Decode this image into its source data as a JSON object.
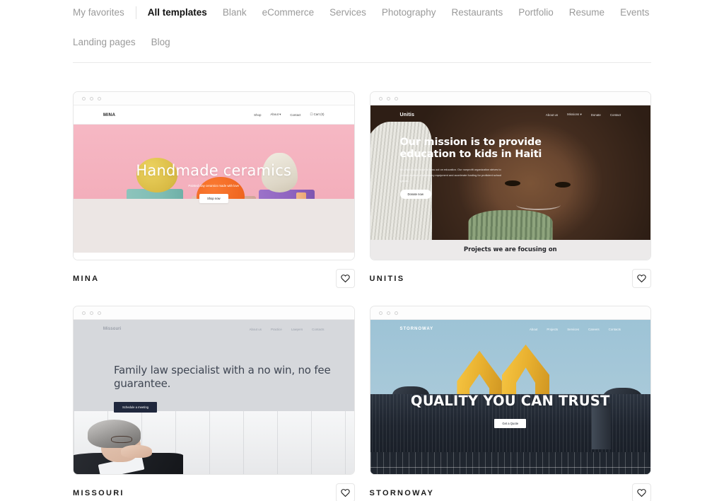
{
  "filter_bar": {
    "rows": [
      [
        {
          "label": "My favorites",
          "active": false
        },
        {
          "divider": true
        },
        {
          "label": "All templates",
          "active": true
        },
        {
          "label": "Blank",
          "active": false
        },
        {
          "label": "eCommerce",
          "active": false
        },
        {
          "label": "Services",
          "active": false
        },
        {
          "label": "Photography",
          "active": false
        },
        {
          "label": "Restaurants",
          "active": false
        },
        {
          "label": "Portfolio",
          "active": false
        },
        {
          "label": "Resume",
          "active": false
        },
        {
          "label": "Events",
          "active": false
        }
      ],
      [
        {
          "label": "Landing pages",
          "active": false
        },
        {
          "label": "Blog",
          "active": false
        }
      ]
    ]
  },
  "templates": [
    {
      "name": "MINA",
      "favorite_icon": "heart-icon",
      "site": {
        "brand": "MINA",
        "nav": [
          "Shop",
          "About  ▾",
          "Contact",
          "☐ Cart (0)"
        ],
        "title": "Handmade ceramics",
        "subtitle": "Painted clay ceramics made with love",
        "cta": "Shop now"
      }
    },
    {
      "name": "UNITIS",
      "favorite_icon": "heart-icon",
      "site": {
        "brand": "Unitis",
        "nav": [
          "About us",
          "Missions  ▾",
          "Donate",
          "Contact"
        ],
        "title": "Our mission is to provide education to kids in Haiti",
        "subtitle": "No child should have to miss out on education. Our nonprofit organization strives to provide access to necessary equipment and accelerate funding for proficient school spaces.",
        "cta": "Donate now",
        "band": "Projects we are focusing on"
      }
    },
    {
      "name": "MISSOURI",
      "favorite_icon": "heart-icon",
      "site": {
        "brand": "Missouri",
        "nav": [
          "About us",
          "Practice",
          "Lawyers",
          "Contacts"
        ],
        "title": "Family law specialist with a no win, no fee guarantee.",
        "cta": "Schedule a meeting"
      }
    },
    {
      "name": "STORNOWAY",
      "favorite_icon": "heart-icon",
      "site": {
        "brand": "STORNOWAY",
        "nav": [
          "About",
          "Projects",
          "Services",
          "Careers",
          "Contacts"
        ],
        "title": "QUALITY YOU CAN TRUST",
        "cta": "Get a Quote"
      }
    }
  ],
  "colors": {
    "text_primary": "#1b1b1b",
    "text_muted": "#9a9a9a",
    "border": "#e6e6e6",
    "missouri_button": "#20283d",
    "unitis_band": "#eceaea"
  }
}
